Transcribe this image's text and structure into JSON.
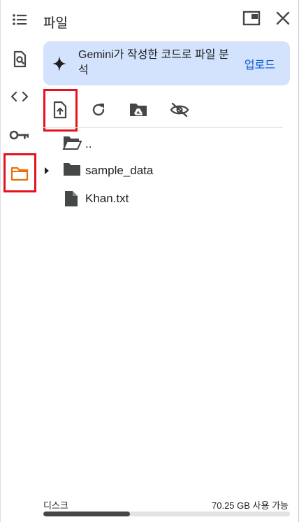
{
  "panel": {
    "title": "파일"
  },
  "rail": {
    "items": [
      {
        "icon": "table-of-contents-icon"
      },
      {
        "icon": "find-in-page-icon"
      },
      {
        "icon": "code-icon"
      },
      {
        "icon": "key-icon"
      },
      {
        "icon": "folder-icon",
        "active": true,
        "active_color": "#e8710a"
      }
    ]
  },
  "banner": {
    "text": "Gemini가 작성한 코드로 파일 분석",
    "action_label": "업로드"
  },
  "toolbar": {
    "items": [
      "upload-file-icon",
      "refresh-icon",
      "mount-drive-icon",
      "hide-files-icon"
    ]
  },
  "files": [
    {
      "name": "..",
      "type": "parent-folder"
    },
    {
      "name": "sample_data",
      "type": "folder",
      "expandable": true
    },
    {
      "name": "Khan.txt",
      "type": "file"
    }
  ],
  "disk": {
    "label": "디스크",
    "free_text": "70.25 GB 사용 가능",
    "used_fraction": 0.35
  },
  "colors": {
    "accent": "#0b57d0",
    "banner_bg": "#d3e3fd",
    "highlight_box": "#e5121f",
    "active_folder": "#e8710a"
  }
}
